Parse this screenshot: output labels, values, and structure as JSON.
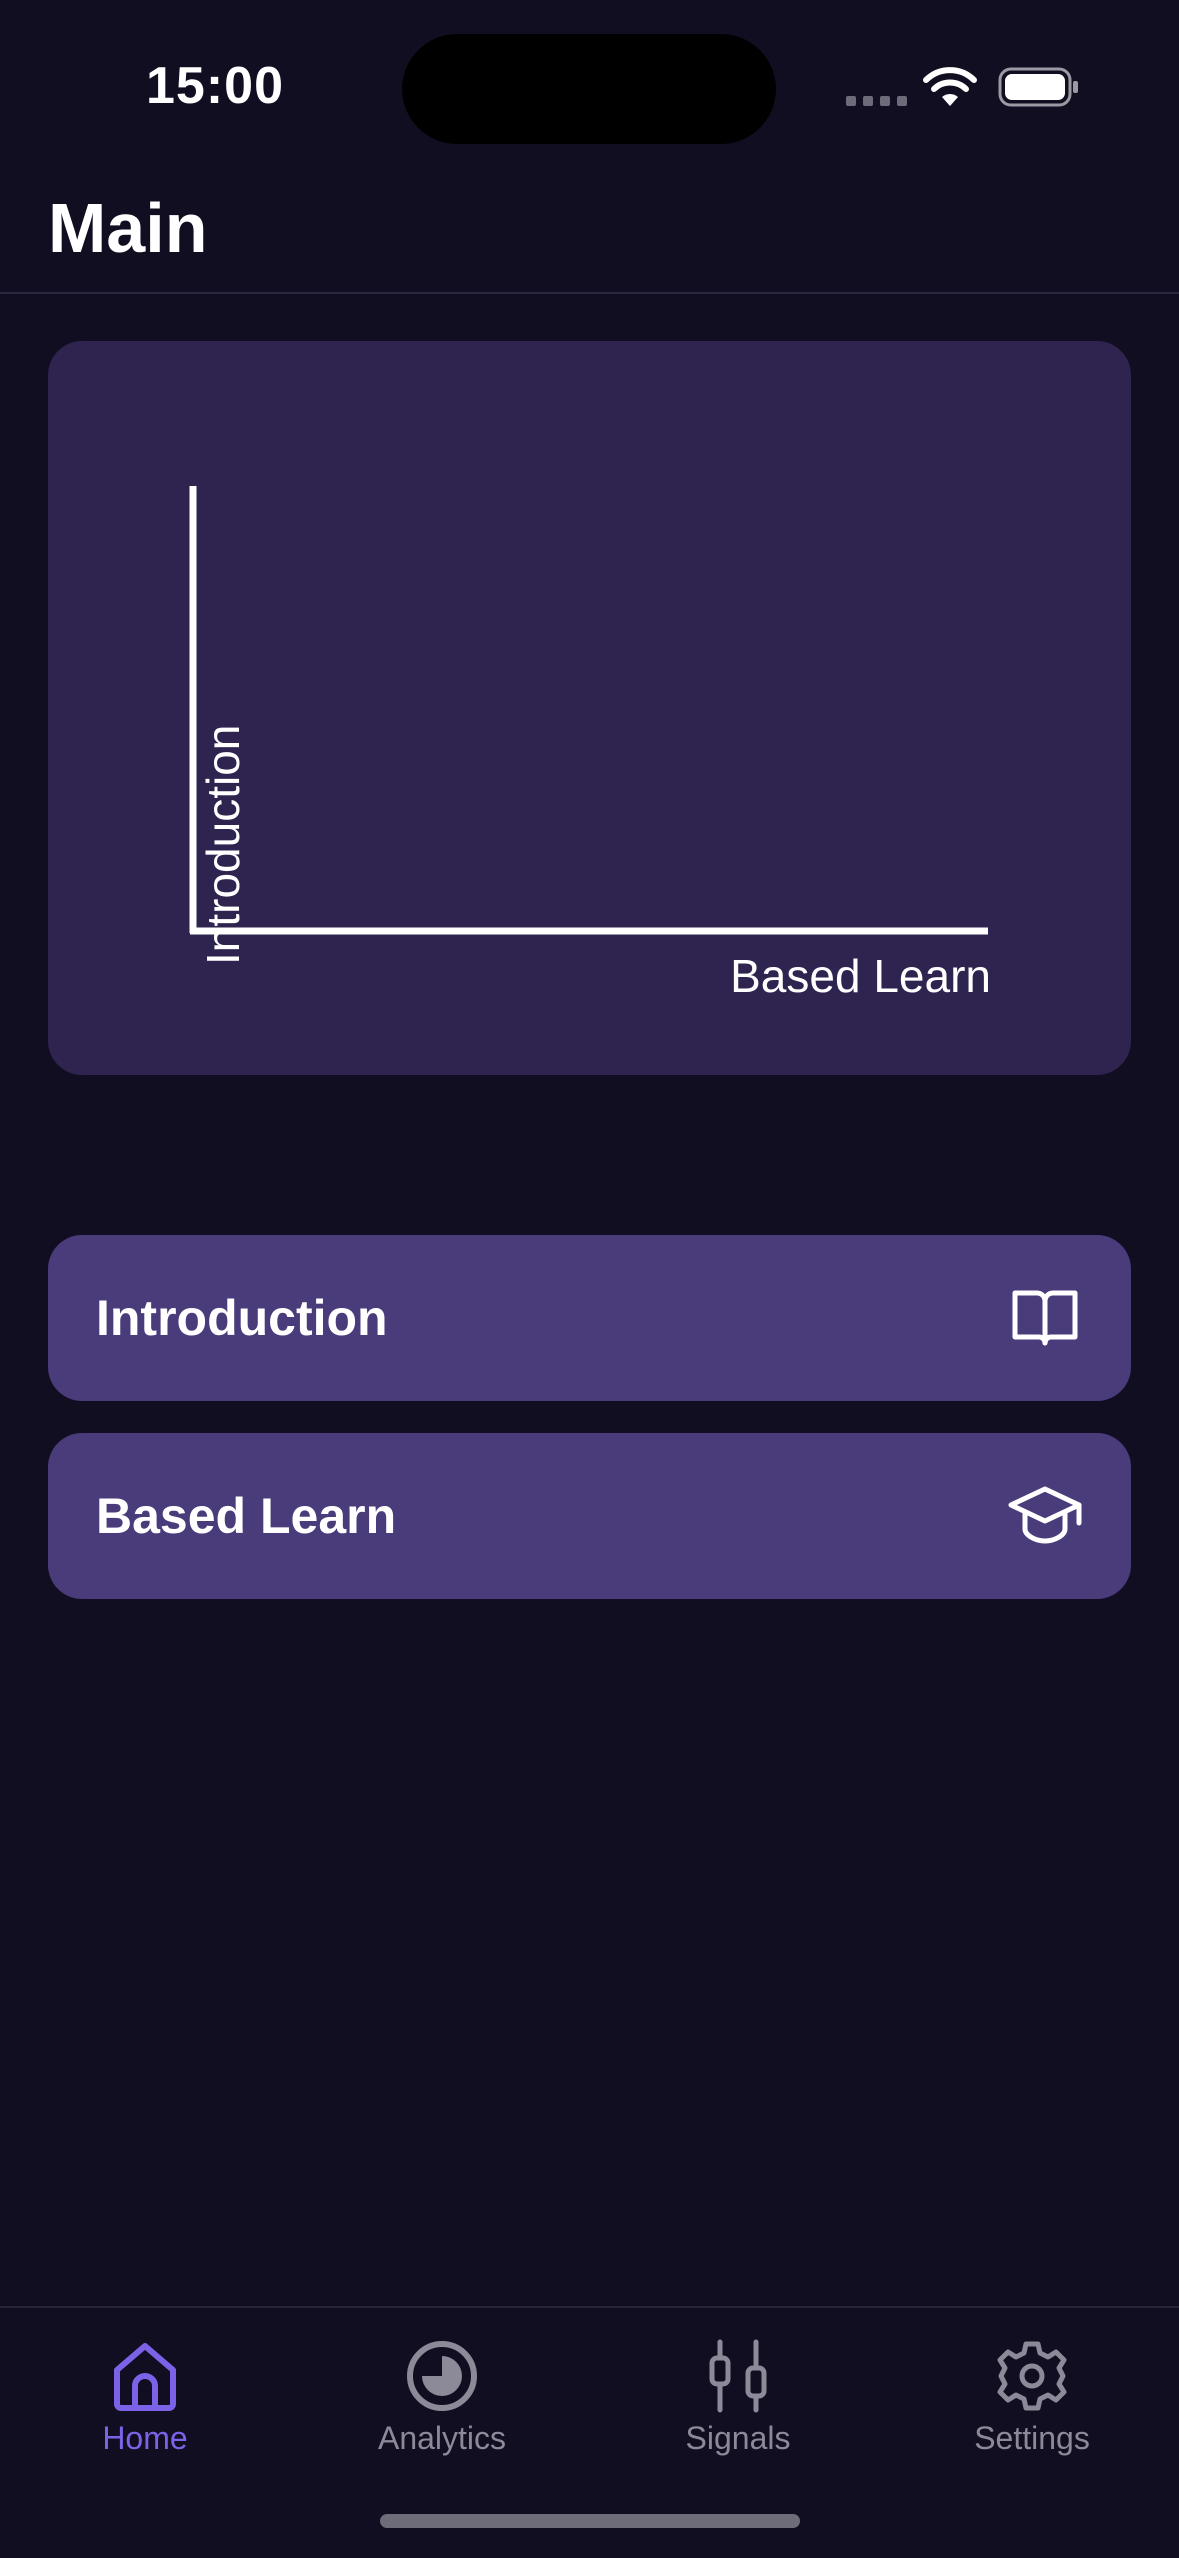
{
  "status_bar": {
    "time": "15:00"
  },
  "header": {
    "title": "Main"
  },
  "chart": {
    "y_label": "Introduction",
    "x_label": "Based Learn"
  },
  "menu": {
    "items": [
      {
        "label": "Introduction",
        "icon": "book-icon"
      },
      {
        "label": "Based Learn",
        "icon": "graduation-cap-icon"
      }
    ]
  },
  "tab_bar": {
    "tabs": [
      {
        "label": "Home",
        "icon": "home-icon",
        "active": true
      },
      {
        "label": "Analytics",
        "icon": "pie-chart-icon",
        "active": false
      },
      {
        "label": "Signals",
        "icon": "candlestick-icon",
        "active": false
      },
      {
        "label": "Settings",
        "icon": "gear-icon",
        "active": false
      }
    ]
  },
  "colors": {
    "background": "#120e22",
    "card": "#2f2450",
    "button": "#4a3b7b",
    "accent": "#7c62e6",
    "inactive": "#8c8998"
  }
}
